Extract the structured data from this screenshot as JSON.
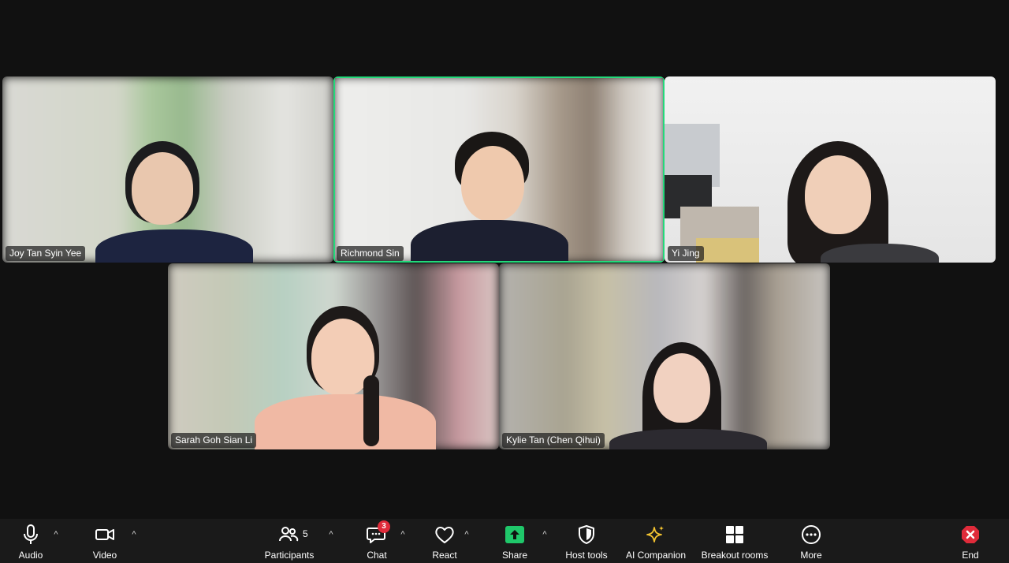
{
  "participants_tiles": [
    {
      "name": "Joy Tan Syin Yee",
      "active": false
    },
    {
      "name": "Richmond Sin",
      "active": true
    },
    {
      "name": "Yi Jing",
      "active": false
    },
    {
      "name": "Sarah Goh Sian Li",
      "active": false
    },
    {
      "name": "Kylie Tan (Chen Qihui)",
      "active": false
    }
  ],
  "toolbar": {
    "audio_label": "Audio",
    "video_label": "Video",
    "participants_label": "Participants",
    "participants_count": "5",
    "chat_label": "Chat",
    "chat_badge": "3",
    "react_label": "React",
    "share_label": "Share",
    "host_tools_label": "Host tools",
    "ai_companion_label": "AI Companion",
    "breakout_rooms_label": "Breakout rooms",
    "more_label": "More",
    "end_label": "End"
  },
  "colors": {
    "active_speaker_border": "#23d97a",
    "share_green": "#1fc76a",
    "end_red": "#e02b3a",
    "ai_companion_yellow": "#f4c430",
    "background": "#111111"
  },
  "icons": {
    "audio": "microphone-icon",
    "video": "camera-icon",
    "participants": "people-icon",
    "chat": "chat-bubble-icon",
    "react": "heart-icon",
    "share": "share-arrow-icon",
    "host_tools": "shield-icon",
    "ai_companion": "sparkle-icon",
    "breakout_rooms": "grid-icon",
    "more": "more-dots-icon",
    "end": "end-call-icon"
  }
}
